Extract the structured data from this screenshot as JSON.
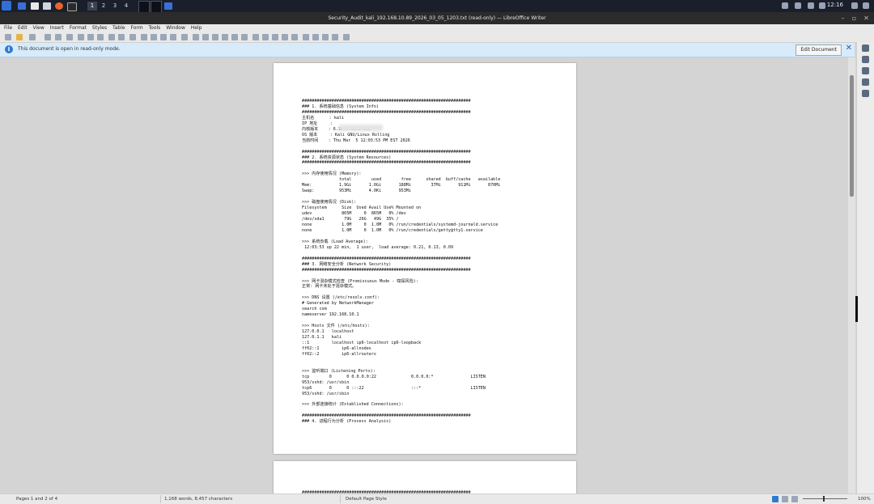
{
  "panel": {
    "workspaces": [
      "1",
      "2",
      "3",
      "4"
    ],
    "active_workspace": "1",
    "clock": "12:16",
    "icons": [
      "kali-menu-icon",
      "desktop-icon",
      "folder-icon",
      "firefox-icon",
      "terminal-icon"
    ]
  },
  "window": {
    "title": "Security_Audit_kali_192.168.10.89_2026_03_05_1203.txt (read-only) — LibreOffice Writer"
  },
  "menu": {
    "items": [
      "File",
      "Edit",
      "View",
      "Insert",
      "Format",
      "Styles",
      "Table",
      "Form",
      "Tools",
      "Window",
      "Help"
    ]
  },
  "infobar": {
    "message": "This document is open in read-only mode.",
    "edit_button": "Edit Document",
    "accent": "#d7ebfb"
  },
  "document": {
    "page1_text": "####################################################################\n### 1. 系统基础信息 (System Info)\n####################################################################\n主机名      : kali\nIP 地址     :\n内核版本    : 6.18.9-kali-amd\nOS 版本     : Kali GNU/Linux Rolling\n当前时间    : Thu Mar  5 12:03:53 PM EST 2026\n\n####################################################################\n### 2. 系统资源状态 (System Resources)\n####################################################################\n\n>>> 内存使用情况 (Memory):\n               total        used        free      shared  buff/cache   available\nMem:           1.9Gi       1.0Gi       188Mi        37Mi       911Mi       870Mi\nSwap:          953Mi       4.0Ki       953Mi\n\n>>> 磁盘使用情况 (Disk):\nFilesystem      Size  Used Avail Use% Mounted on\nudev            865M     0  865M   0% /dev\n/dev/sda1        79G   26G   49G  35% /\nnone            1.0M     0  1.0M   0% /run/credentials/systemd-journald.service\nnone            1.0M     0  1.0M   0% /run/credentials/getty@tty1.service\n\n>>> 系统负载 (Load Average):\n 12:03:53 up 22 min,  1 user,  load average: 0.21, 0.13, 0.09\n\n####################################################################\n### 3. 网络安全分析 (Network Security)\n####################################################################\n\n>>> 网卡混杂模式检查 (Promiscuous Mode - 嗅探风险):\n正常: 网卡未处于混杂模式。\n\n>>> DNS 设置 (/etc/resolv.conf):\n# Generated by NetworkManager\nsearch com\nnameserver 192.168.10.1\n\n>>> Hosts 文件 (/etc/hosts):\n127.0.0.1   localhost\n127.0.1.1   kali\n::1         localhost ip6-localhost ip6-loopback\nff02::1         ip6-allnodes\nff02::2         ip6-allrouters\n\n\n>>> 监听端口 (Listening Ports):\ntcp        0      0 0.0.0.0:22              0.0.0.0:*               LISTEN\n953/sshd: /usr/sbin\ntcp6       0      0 :::22                   :::*                    LISTEN\n953/sshd: /usr/sbin\n\n>>> 外部连接统计 (Established Connections):\n\n####################################################################\n### 4. 进程行为分析 (Process Analysis)",
    "page2_text": "####################################################################"
  },
  "statusbar": {
    "page": "Pages 1 and 2 of 4",
    "words": "1,168 words, 8,457 characters",
    "style": "Default Page Style",
    "zoom": "100%"
  }
}
